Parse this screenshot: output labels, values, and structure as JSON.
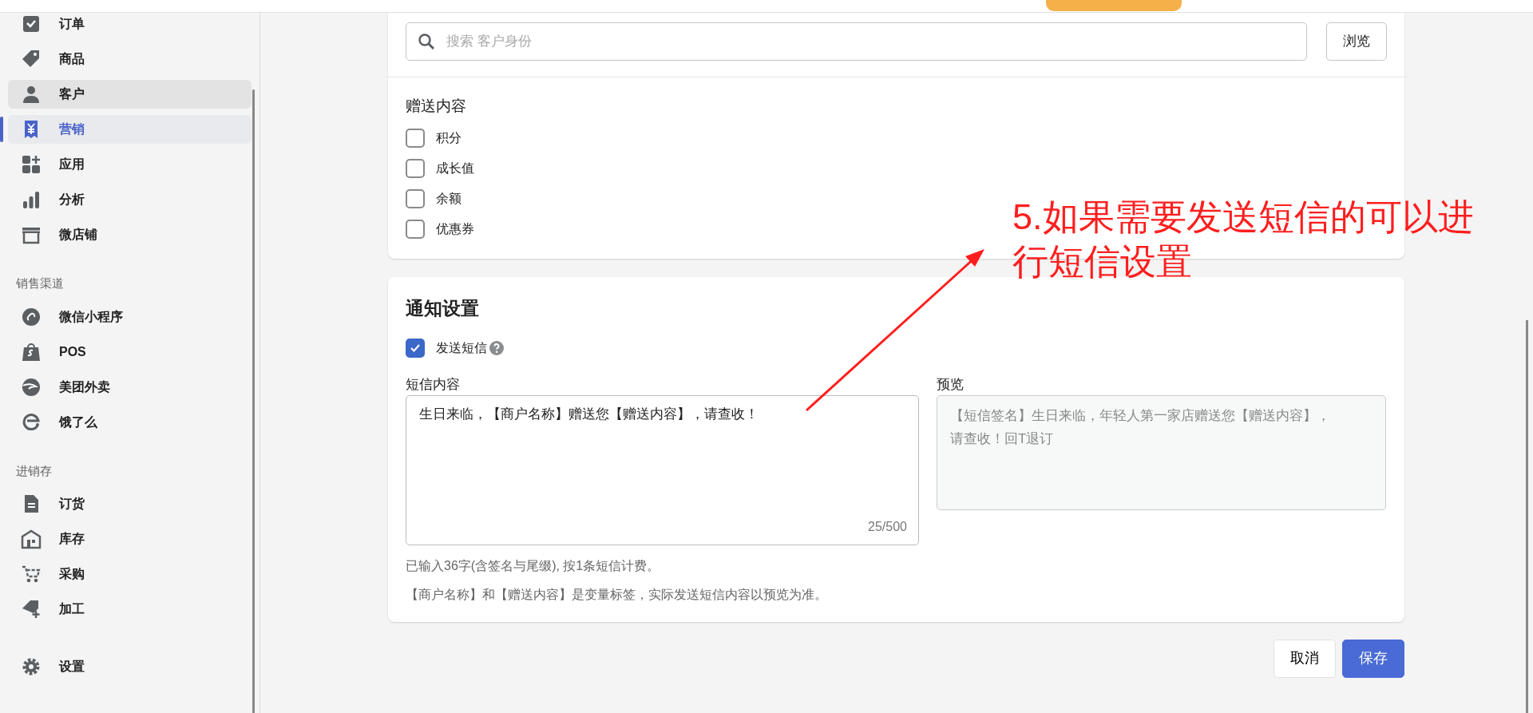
{
  "sidebar": {
    "sections": [
      {
        "items": [
          {
            "label": "订单",
            "selected": false,
            "hovered": false
          },
          {
            "label": "商品",
            "selected": false,
            "hovered": false
          },
          {
            "label": "客户",
            "selected": false,
            "hovered": true
          },
          {
            "label": "营销",
            "selected": true,
            "hovered": false
          },
          {
            "label": "应用",
            "selected": false,
            "hovered": false
          },
          {
            "label": "分析",
            "selected": false,
            "hovered": false
          },
          {
            "label": "微店铺",
            "selected": false,
            "hovered": false
          }
        ]
      },
      {
        "title": "销售渠道",
        "items": [
          {
            "label": "微信小程序",
            "selected": false,
            "hovered": false
          },
          {
            "label": "POS",
            "selected": false,
            "hovered": false
          },
          {
            "label": "美团外卖",
            "selected": false,
            "hovered": false
          },
          {
            "label": "饿了么",
            "selected": false,
            "hovered": false
          }
        ]
      },
      {
        "title": "进销存",
        "items": [
          {
            "label": "订货",
            "selected": false,
            "hovered": false
          },
          {
            "label": "库存",
            "selected": false,
            "hovered": false
          },
          {
            "label": "采购",
            "selected": false,
            "hovered": false
          },
          {
            "label": "加工",
            "selected": false,
            "hovered": false
          }
        ]
      },
      {
        "items": [
          {
            "label": "设置",
            "selected": false,
            "hovered": false
          }
        ]
      }
    ]
  },
  "customer_search": {
    "placeholder": "搜索 客户身份",
    "browse_button": "浏览"
  },
  "gift_content": {
    "title": "赠送内容",
    "options": [
      {
        "label": "积分",
        "checked": false
      },
      {
        "label": "成长值",
        "checked": false
      },
      {
        "label": "余额",
        "checked": false
      },
      {
        "label": "优惠券",
        "checked": false
      }
    ]
  },
  "notification": {
    "title": "通知设置",
    "send_sms": {
      "label": "发送短信",
      "checked": true
    },
    "sms_content": {
      "label": "短信内容",
      "value": "生日来临，【商户名称】赠送您【赠送内容】，请查收！",
      "counter": "25/500"
    },
    "preview": {
      "label": "预览",
      "text": "【短信签名】生日来临，年轻人第一家店赠送您【赠送内容】，请查收！回T退订"
    },
    "hints": [
      "已输入36字(含签名与尾缀), 按1条短信计费。",
      "【商户名称】和【赠送内容】是变量标签，实际发送短信内容以预览为准。"
    ]
  },
  "footer_buttons": [
    {
      "label": "取消",
      "kind": "secondary"
    },
    {
      "label": "保存",
      "kind": "primary"
    }
  ],
  "annotation": {
    "text": "5.如果需要发送短信的可以进行短信设置"
  }
}
